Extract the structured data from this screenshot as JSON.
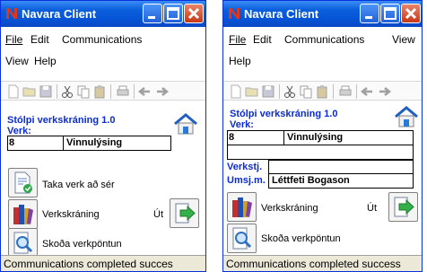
{
  "left": {
    "title": "Navara Client",
    "menu": {
      "file": "File",
      "edit": "Edit",
      "communications": "Communications",
      "view": "View",
      "help": "Help"
    },
    "heading": "Stólpi verkskráning 1.0",
    "verk_label": "Verk:",
    "verk_number": "8",
    "verk_name": "Vinnulýsing",
    "actions": {
      "take": "Taka verk að sér",
      "register": "Verkskráning",
      "out": "Út",
      "view_order": "Skoða verkpöntun"
    },
    "status": "Communications completed succes"
  },
  "right": {
    "title": "Navara Client",
    "menu": {
      "file": "File",
      "edit": "Edit",
      "communications": "Communications",
      "view": "View",
      "help": "Help"
    },
    "heading": "Stólpi verkskráning 1.0",
    "verk_label": "Verk:",
    "verk_number": "8",
    "verk_name": "Vinnulýsing",
    "verkstj_label": "Verkstj.",
    "umsj_label": "Umsj.m.",
    "umsj_value": "Léttfeti Bogason",
    "actions": {
      "register": "Verkskráning",
      "out": "Út",
      "view_order": "Skoða verkpöntun"
    },
    "status": "Communications completed success"
  },
  "colors": {
    "titlebar": "#0a5fdc",
    "heading": "#0a2bd6",
    "close_button": "#c63815"
  },
  "icons": [
    "navara-logo-icon",
    "minimize-icon",
    "maximize-icon",
    "close-icon",
    "new-icon",
    "open-icon",
    "save-icon",
    "cut-icon",
    "copy-icon",
    "paste-icon",
    "print-icon",
    "back-icon",
    "forward-icon",
    "home-icon",
    "document-check-icon",
    "books-icon",
    "exit-arrow-icon",
    "magnifier-icon"
  ]
}
